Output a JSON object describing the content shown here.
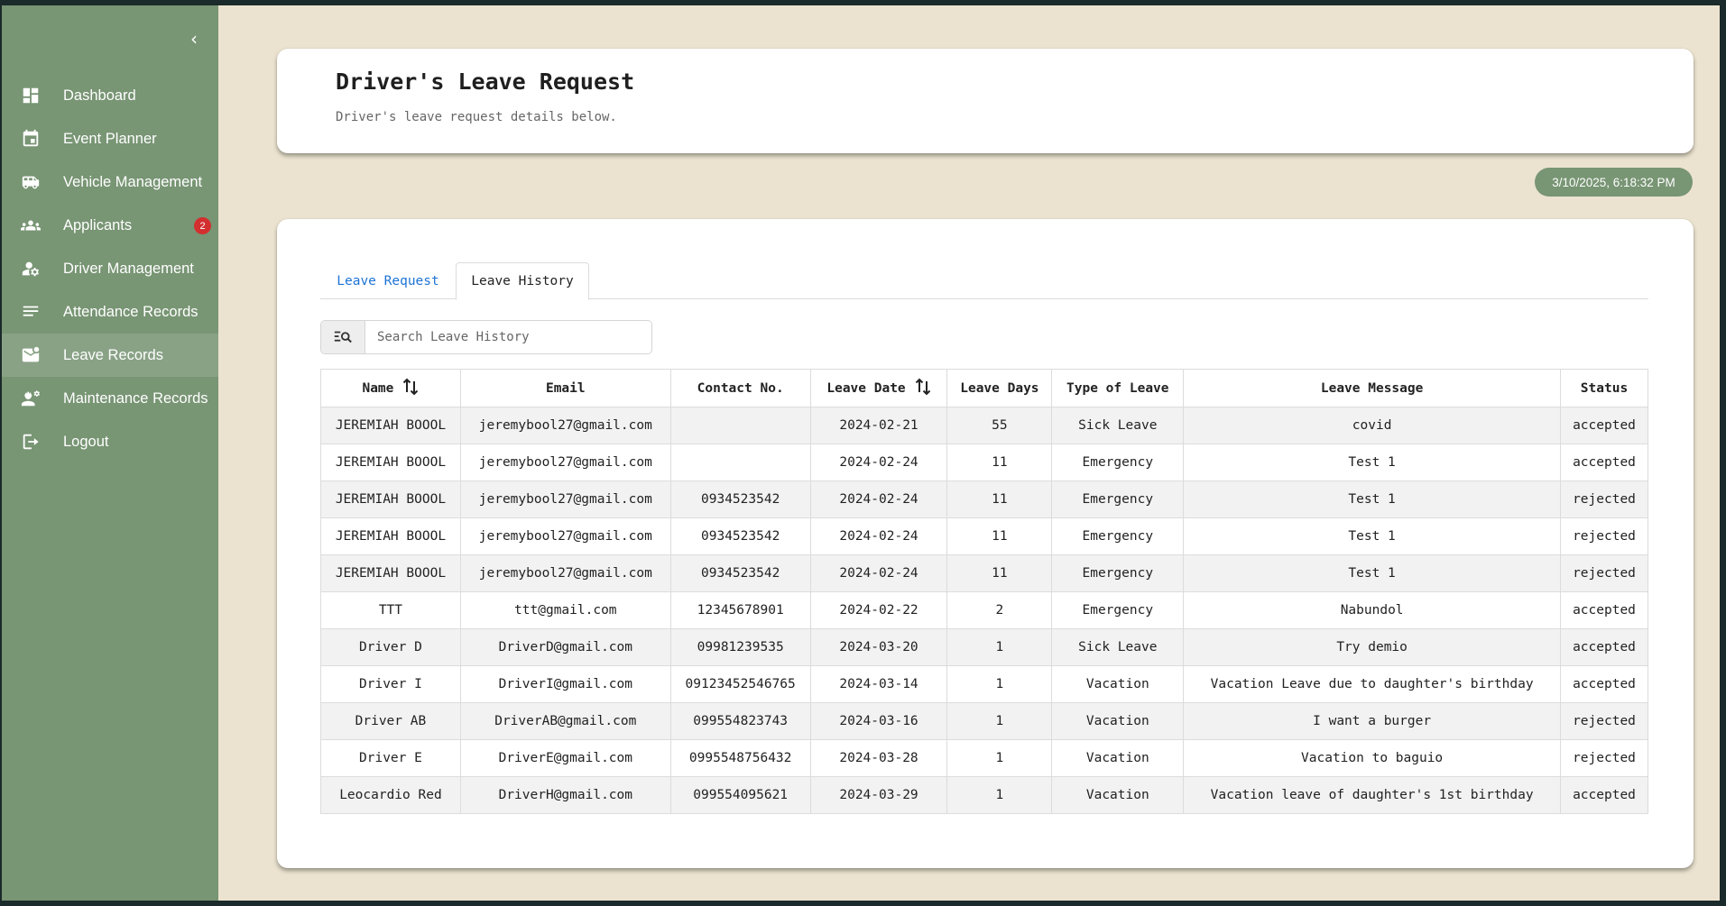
{
  "sidebar": {
    "items": [
      {
        "label": "Dashboard",
        "icon": "dashboard-icon"
      },
      {
        "label": "Event Planner",
        "icon": "calendar-icon"
      },
      {
        "label": "Vehicle Management",
        "icon": "bus-icon"
      },
      {
        "label": "Applicants",
        "icon": "group-icon",
        "badge": "2"
      },
      {
        "label": "Driver Management",
        "icon": "person-gear-icon"
      },
      {
        "label": "Attendance Records",
        "icon": "lines-icon"
      },
      {
        "label": "Leave Records",
        "icon": "mail-icon",
        "active": true
      },
      {
        "label": "Maintenance Records",
        "icon": "engineering-icon"
      },
      {
        "label": "Logout",
        "icon": "logout-icon"
      }
    ]
  },
  "header": {
    "title": "Driver's Leave Request",
    "subtitle": "Driver's leave request details below."
  },
  "timestamp": "3/10/2025, 6:18:32 PM",
  "tabs": [
    {
      "label": "Leave Request",
      "active": false
    },
    {
      "label": "Leave History",
      "active": true
    }
  ],
  "search": {
    "placeholder": "Search Leave History",
    "value": ""
  },
  "table": {
    "columns": [
      "Name",
      "Email",
      "Contact No.",
      "Leave Date",
      "Leave Days",
      "Type of Leave",
      "Leave Message",
      "Status"
    ],
    "rows": [
      [
        "JEREMIAH BOOOL",
        "jeremybool27@gmail.com",
        "",
        "2024-02-21",
        "55",
        "Sick Leave",
        "covid",
        "accepted"
      ],
      [
        "JEREMIAH BOOOL",
        "jeremybool27@gmail.com",
        "",
        "2024-02-24",
        "11",
        "Emergency",
        "Test 1",
        "accepted"
      ],
      [
        "JEREMIAH BOOOL",
        "jeremybool27@gmail.com",
        "0934523542",
        "2024-02-24",
        "11",
        "Emergency",
        "Test 1",
        "rejected"
      ],
      [
        "JEREMIAH BOOOL",
        "jeremybool27@gmail.com",
        "0934523542",
        "2024-02-24",
        "11",
        "Emergency",
        "Test 1",
        "rejected"
      ],
      [
        "JEREMIAH BOOOL",
        "jeremybool27@gmail.com",
        "0934523542",
        "2024-02-24",
        "11",
        "Emergency",
        "Test 1",
        "rejected"
      ],
      [
        "TTT",
        "ttt@gmail.com",
        "12345678901",
        "2024-02-22",
        "2",
        "Emergency",
        "Nabundol",
        "accepted"
      ],
      [
        "Driver D",
        "DriverD@gmail.com",
        "09981239535",
        "2024-03-20",
        "1",
        "Sick Leave",
        "Try demio",
        "accepted"
      ],
      [
        "Driver I",
        "DriverI@gmail.com",
        "09123452546765",
        "2024-03-14",
        "1",
        "Vacation",
        "Vacation Leave due to daughter's birthday",
        "accepted"
      ],
      [
        "Driver AB",
        "DriverAB@gmail.com",
        "099554823743",
        "2024-03-16",
        "1",
        "Vacation",
        "I want a burger",
        "rejected"
      ],
      [
        "Driver E",
        "DriverE@gmail.com",
        "0995548756432",
        "2024-03-28",
        "1",
        "Vacation",
        "Vacation to baguio",
        "rejected"
      ],
      [
        "Leocardio Red",
        "DriverH@gmail.com",
        "099554095621",
        "2024-03-29",
        "1",
        "Vacation",
        "Vacation leave of daughter's 1st birthday",
        "accepted"
      ]
    ]
  },
  "colors": {
    "sidebar": "#789574",
    "sidebar_active": "#89a286",
    "background": "#ebe3cf",
    "badge": "#d32f2f",
    "tab_link": "#1e73d6"
  }
}
